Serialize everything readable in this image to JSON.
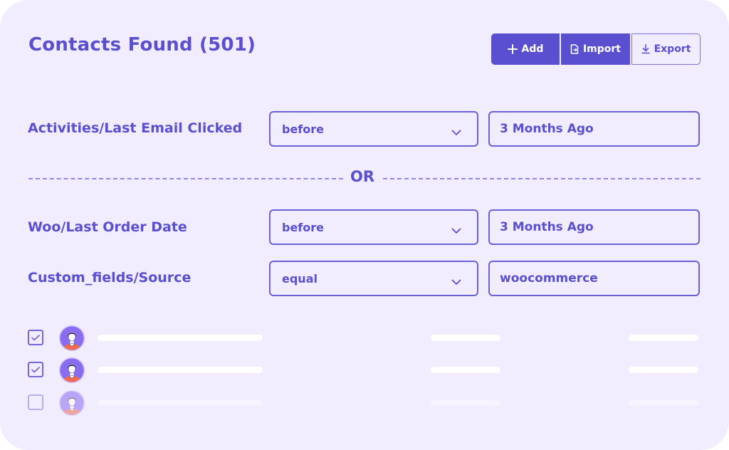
{
  "header": {
    "title": "Contacts Found (501)"
  },
  "toolbar": {
    "add_label": "Add",
    "import_label": "Import",
    "export_label": "Export"
  },
  "filters": [
    {
      "field": "Activities/Last Email Clicked",
      "operator": "before",
      "value": "3 Months Ago"
    },
    {
      "field": "Woo/Last Order Date",
      "operator": "before",
      "value": "3 Months Ago"
    },
    {
      "field": "Custom_fields/Source",
      "operator": "equal",
      "value": "woocommerce"
    }
  ],
  "divider": {
    "label": "OR"
  },
  "contacts": [
    {
      "checked": true
    },
    {
      "checked": true
    },
    {
      "checked": false
    }
  ],
  "colors": {
    "accent": "#5a4fcf",
    "background": "#f1ecfe",
    "avatar_bg": "#8a6cf0",
    "avatar_shirt": "#f26b4f"
  }
}
